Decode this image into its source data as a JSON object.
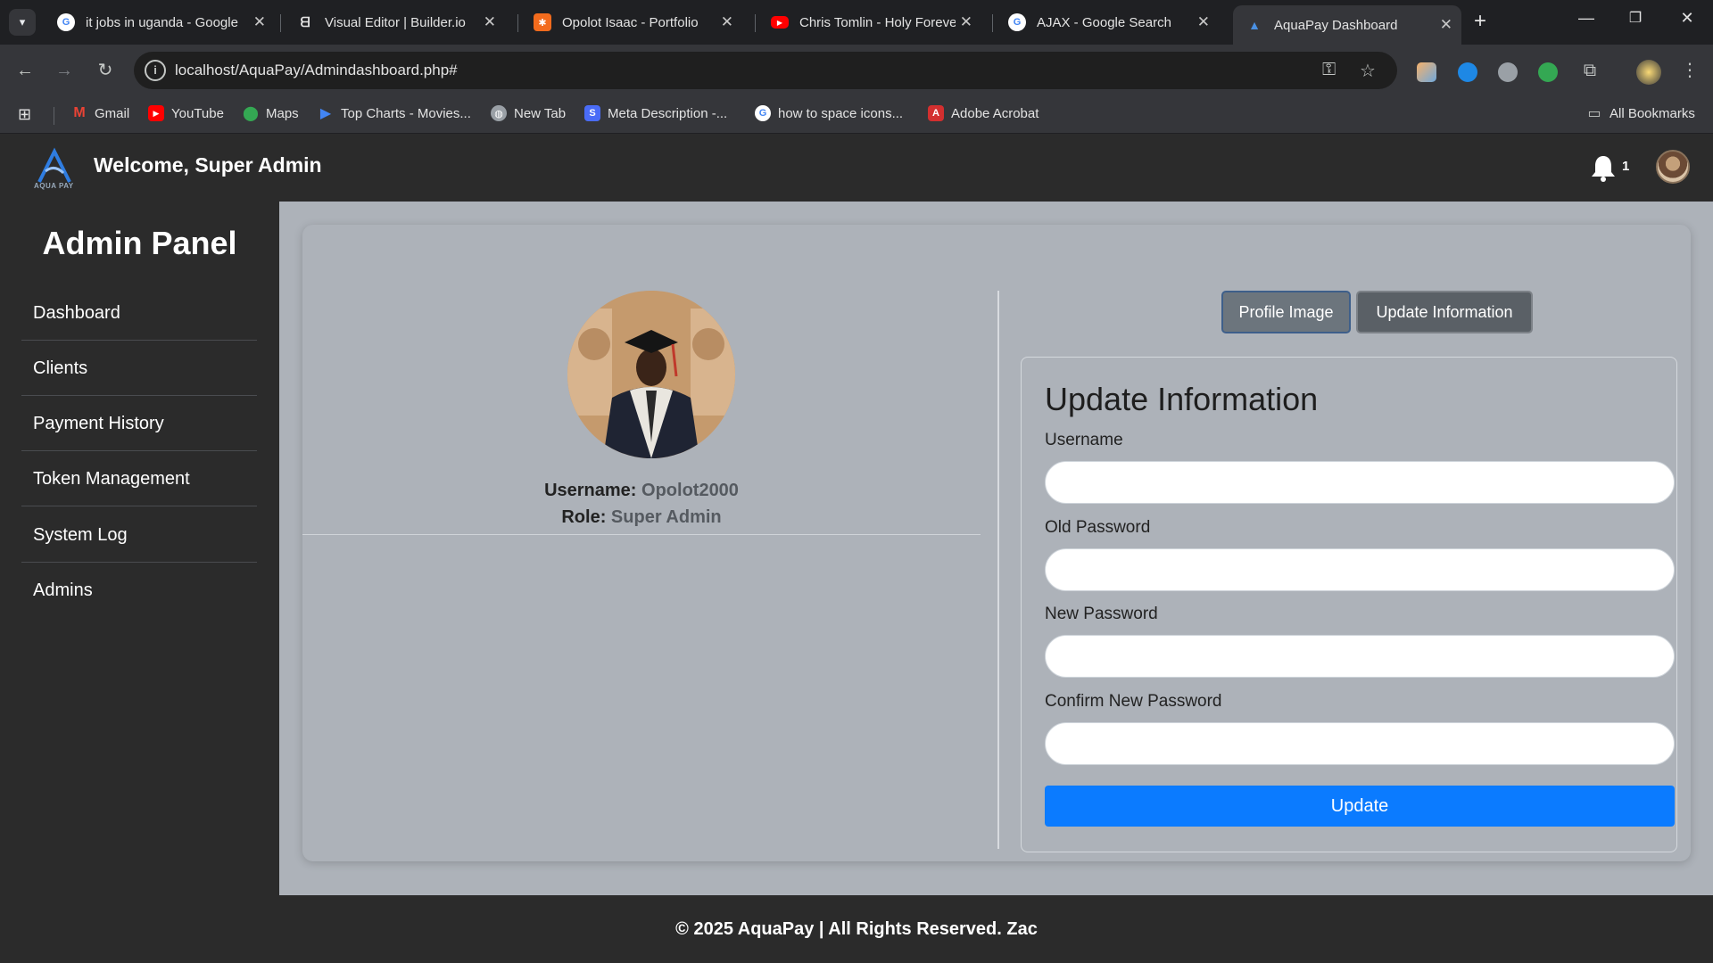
{
  "browser": {
    "tabs": [
      {
        "title": "it jobs in uganda - Google",
        "icon": "google-icon"
      },
      {
        "title": "Visual Editor | Builder.io",
        "icon": "builder-icon"
      },
      {
        "title": "Opolot Isaac - Portfolio",
        "icon": "portfolio-icon"
      },
      {
        "title": "Chris Tomlin - Holy Forever",
        "icon": "youtube-icon"
      },
      {
        "title": "AJAX - Google Search",
        "icon": "google-icon"
      },
      {
        "title": "AquaPay Dashboard",
        "icon": "aquapay-icon",
        "active": true
      }
    ],
    "url": "localhost/AquaPay/Admindashboard.php#",
    "bookmarks": [
      {
        "label": "Gmail"
      },
      {
        "label": "YouTube"
      },
      {
        "label": "Maps"
      },
      {
        "label": "Top Charts - Movies..."
      },
      {
        "label": "New Tab"
      },
      {
        "label": "Meta Description -..."
      },
      {
        "label": "how to space icons..."
      },
      {
        "label": "Adobe Acrobat"
      }
    ],
    "all_bookmarks_label": "All Bookmarks"
  },
  "header": {
    "logo_caption": "AQUA PAY",
    "welcome": "Welcome, Super Admin",
    "notification_count": "1"
  },
  "sidebar": {
    "title": "Admin Panel",
    "items": [
      {
        "label": "Dashboard"
      },
      {
        "label": "Clients"
      },
      {
        "label": "Payment History"
      },
      {
        "label": "Token Management"
      },
      {
        "label": "System Log"
      },
      {
        "label": "Admins"
      }
    ]
  },
  "profile": {
    "username_label": "Username:",
    "username": "Opolot2000",
    "role_label": "Role:",
    "role": "Super Admin"
  },
  "tabs": {
    "profile_image": "Profile Image",
    "update_information": "Update Information"
  },
  "form": {
    "title": "Update Information",
    "fields": [
      {
        "label": "Username",
        "value": ""
      },
      {
        "label": "Old Password",
        "value": ""
      },
      {
        "label": "New Password",
        "value": ""
      },
      {
        "label": "Confirm New Password",
        "value": ""
      }
    ],
    "submit": "Update"
  },
  "footer": {
    "text": "© 2025 AquaPay | All Rights Reserved. Zac"
  },
  "colors": {
    "primary_button": "#0b7bff",
    "content_bg": "#adb2b9",
    "dark_bg": "#2b2b2b"
  }
}
